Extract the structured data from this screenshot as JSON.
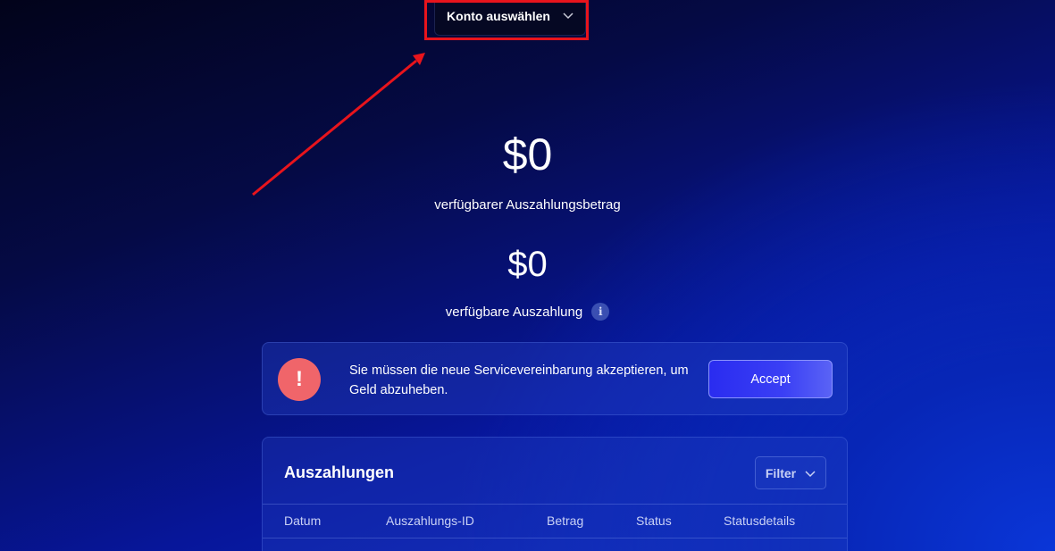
{
  "account_select": {
    "label": "Konto auswählen",
    "icon": "chevron-down-icon"
  },
  "balance": {
    "payout_amount": "$0",
    "payout_amount_caption": "verfügbarer Auszahlungsbetrag",
    "available_payout": "$0",
    "available_payout_caption": "verfügbare Auszahlung",
    "info_icon_glyph": "i"
  },
  "notice": {
    "icon_glyph": "!",
    "message": "Sie müssen die neue Servicevereinbarung akzeptieren, um Geld abzuheben.",
    "accept_label": "Accept"
  },
  "payouts": {
    "title": "Auszahlungen",
    "filter_label": "Filter",
    "columns": [
      "Datum",
      "Auszahlungs-ID",
      "Betrag",
      "Status",
      "Statusdetails"
    ]
  },
  "colors": {
    "annotation": "#e8141c",
    "accent_button": "#2a2cf0",
    "alert": "#f0656a"
  }
}
